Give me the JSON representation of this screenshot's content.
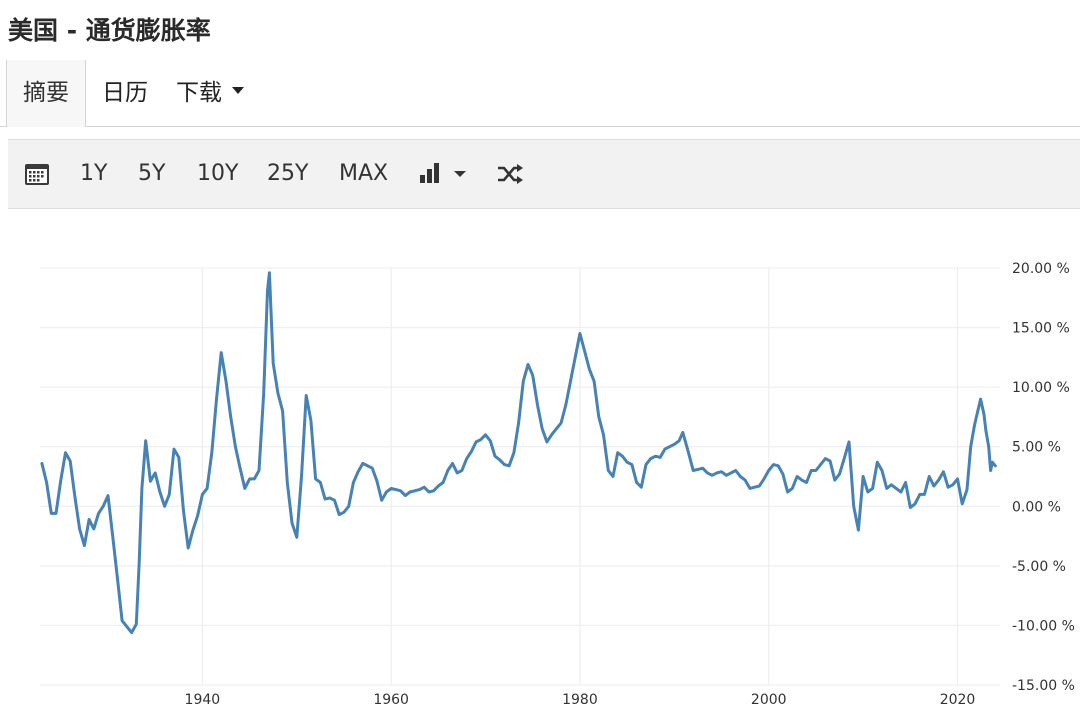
{
  "title": "美国 - 通货膨胀率",
  "tabs": [
    {
      "label": "摘要",
      "active": true
    },
    {
      "label": "日历"
    },
    {
      "label": "下载"
    }
  ],
  "toolbar": {
    "ranges": [
      "1Y",
      "5Y",
      "10Y",
      "25Y",
      "MAX"
    ],
    "icons": [
      "calendar-icon",
      "bar-chart-icon",
      "chevron-down-icon",
      "shuffle-icon"
    ]
  },
  "colors": {
    "line": "#4682b4",
    "grid": "#ececec",
    "toolbar_bg": "#f2f2f2"
  },
  "chart_data": {
    "type": "line",
    "title": "",
    "xlabel": "",
    "ylabel": "",
    "xlim": [
      1922.8,
      2024.5
    ],
    "ylim": [
      -15,
      20
    ],
    "x_ticks": [
      1940,
      1960,
      1980,
      2000,
      2020
    ],
    "y_ticks": [
      20,
      15,
      10,
      5,
      0,
      -5,
      -10,
      -15
    ],
    "y_tick_labels": [
      "20.00 %",
      "15.00 %",
      "10.00 %",
      "5.00 %",
      "0.00 %",
      "-5.00 %",
      "-10.00 %",
      "-15.00 %"
    ],
    "grid": true,
    "series": [
      {
        "points": [
          [
            1923.0,
            3.6
          ],
          [
            1923.5,
            2.0
          ],
          [
            1924.0,
            -0.6
          ],
          [
            1924.5,
            -0.6
          ],
          [
            1925.0,
            2.2
          ],
          [
            1925.5,
            4.5
          ],
          [
            1926.0,
            3.8
          ],
          [
            1926.5,
            0.8
          ],
          [
            1927.0,
            -1.9
          ],
          [
            1927.5,
            -3.3
          ],
          [
            1928.0,
            -1.1
          ],
          [
            1928.5,
            -1.9
          ],
          [
            1929.0,
            -0.6
          ],
          [
            1929.5,
            0.0
          ],
          [
            1930.0,
            0.9
          ],
          [
            1930.5,
            -2.5
          ],
          [
            1931.0,
            -6.0
          ],
          [
            1931.5,
            -9.6
          ],
          [
            1932.0,
            -10.1
          ],
          [
            1932.5,
            -10.6
          ],
          [
            1933.0,
            -9.9
          ],
          [
            1933.3,
            -4.9
          ],
          [
            1933.6,
            1.5
          ],
          [
            1934.0,
            5.5
          ],
          [
            1934.5,
            2.1
          ],
          [
            1935.0,
            2.8
          ],
          [
            1935.5,
            1.2
          ],
          [
            1936.0,
            0.0
          ],
          [
            1936.5,
            1.0
          ],
          [
            1937.0,
            4.8
          ],
          [
            1937.5,
            4.1
          ],
          [
            1938.0,
            -0.4
          ],
          [
            1938.5,
            -3.5
          ],
          [
            1939.0,
            -2.0
          ],
          [
            1939.5,
            -0.8
          ],
          [
            1940.0,
            1.0
          ],
          [
            1940.5,
            1.5
          ],
          [
            1941.0,
            4.5
          ],
          [
            1941.5,
            9.0
          ],
          [
            1942.0,
            12.9
          ],
          [
            1942.5,
            10.5
          ],
          [
            1943.0,
            7.5
          ],
          [
            1943.5,
            5.0
          ],
          [
            1944.0,
            3.2
          ],
          [
            1944.5,
            1.5
          ],
          [
            1945.0,
            2.3
          ],
          [
            1945.5,
            2.3
          ],
          [
            1946.0,
            3.0
          ],
          [
            1946.5,
            9.5
          ],
          [
            1946.9,
            18.1
          ],
          [
            1947.1,
            19.6
          ],
          [
            1947.5,
            12.0
          ],
          [
            1948.0,
            9.5
          ],
          [
            1948.5,
            8.0
          ],
          [
            1949.0,
            2.0
          ],
          [
            1949.5,
            -1.4
          ],
          [
            1950.0,
            -2.6
          ],
          [
            1950.5,
            2.5
          ],
          [
            1951.0,
            9.3
          ],
          [
            1951.5,
            7.2
          ],
          [
            1952.0,
            2.3
          ],
          [
            1952.5,
            2.0
          ],
          [
            1953.0,
            0.6
          ],
          [
            1953.5,
            0.7
          ],
          [
            1954.0,
            0.5
          ],
          [
            1954.5,
            -0.7
          ],
          [
            1955.0,
            -0.5
          ],
          [
            1955.5,
            0.0
          ],
          [
            1956.0,
            2.0
          ],
          [
            1956.5,
            2.9
          ],
          [
            1957.0,
            3.6
          ],
          [
            1957.5,
            3.4
          ],
          [
            1958.0,
            3.2
          ],
          [
            1958.5,
            2.1
          ],
          [
            1959.0,
            0.5
          ],
          [
            1959.5,
            1.2
          ],
          [
            1960.0,
            1.5
          ],
          [
            1960.5,
            1.4
          ],
          [
            1961.0,
            1.3
          ],
          [
            1961.5,
            0.9
          ],
          [
            1962.0,
            1.2
          ],
          [
            1962.5,
            1.3
          ],
          [
            1963.0,
            1.4
          ],
          [
            1963.5,
            1.6
          ],
          [
            1964.0,
            1.2
          ],
          [
            1964.5,
            1.3
          ],
          [
            1965.0,
            1.7
          ],
          [
            1965.5,
            2.0
          ],
          [
            1966.0,
            3.0
          ],
          [
            1966.5,
            3.6
          ],
          [
            1967.0,
            2.8
          ],
          [
            1967.5,
            3.0
          ],
          [
            1968.0,
            4.0
          ],
          [
            1968.5,
            4.6
          ],
          [
            1969.0,
            5.4
          ],
          [
            1969.5,
            5.6
          ],
          [
            1970.0,
            6.0
          ],
          [
            1970.5,
            5.5
          ],
          [
            1971.0,
            4.2
          ],
          [
            1971.5,
            3.9
          ],
          [
            1972.0,
            3.5
          ],
          [
            1972.5,
            3.4
          ],
          [
            1973.0,
            4.5
          ],
          [
            1973.5,
            7.0
          ],
          [
            1974.0,
            10.5
          ],
          [
            1974.5,
            11.9
          ],
          [
            1975.0,
            11.0
          ],
          [
            1975.5,
            8.5
          ],
          [
            1976.0,
            6.5
          ],
          [
            1976.5,
            5.4
          ],
          [
            1977.0,
            6.0
          ],
          [
            1977.5,
            6.5
          ],
          [
            1978.0,
            7.0
          ],
          [
            1978.5,
            8.5
          ],
          [
            1979.0,
            10.5
          ],
          [
            1979.5,
            12.5
          ],
          [
            1980.0,
            14.5
          ],
          [
            1980.5,
            13.0
          ],
          [
            1981.0,
            11.5
          ],
          [
            1981.5,
            10.5
          ],
          [
            1982.0,
            7.5
          ],
          [
            1982.5,
            6.0
          ],
          [
            1983.0,
            3.0
          ],
          [
            1983.5,
            2.5
          ],
          [
            1984.0,
            4.5
          ],
          [
            1984.5,
            4.2
          ],
          [
            1985.0,
            3.7
          ],
          [
            1985.5,
            3.5
          ],
          [
            1986.0,
            2.0
          ],
          [
            1986.5,
            1.6
          ],
          [
            1987.0,
            3.5
          ],
          [
            1987.5,
            4.0
          ],
          [
            1988.0,
            4.2
          ],
          [
            1988.5,
            4.1
          ],
          [
            1989.0,
            4.8
          ],
          [
            1989.5,
            5.0
          ],
          [
            1990.0,
            5.2
          ],
          [
            1990.5,
            5.5
          ],
          [
            1990.9,
            6.2
          ],
          [
            1991.5,
            4.5
          ],
          [
            1992.0,
            3.0
          ],
          [
            1992.5,
            3.1
          ],
          [
            1993.0,
            3.2
          ],
          [
            1993.5,
            2.8
          ],
          [
            1994.0,
            2.6
          ],
          [
            1994.5,
            2.8
          ],
          [
            1995.0,
            2.9
          ],
          [
            1995.5,
            2.6
          ],
          [
            1996.0,
            2.8
          ],
          [
            1996.5,
            3.0
          ],
          [
            1997.0,
            2.5
          ],
          [
            1997.5,
            2.2
          ],
          [
            1998.0,
            1.5
          ],
          [
            1998.5,
            1.6
          ],
          [
            1999.0,
            1.7
          ],
          [
            1999.5,
            2.3
          ],
          [
            2000.0,
            3.0
          ],
          [
            2000.5,
            3.5
          ],
          [
            2001.0,
            3.4
          ],
          [
            2001.5,
            2.7
          ],
          [
            2002.0,
            1.2
          ],
          [
            2002.5,
            1.5
          ],
          [
            2003.0,
            2.5
          ],
          [
            2003.5,
            2.2
          ],
          [
            2004.0,
            2.0
          ],
          [
            2004.5,
            3.0
          ],
          [
            2005.0,
            3.0
          ],
          [
            2005.5,
            3.5
          ],
          [
            2006.0,
            4.0
          ],
          [
            2006.5,
            3.8
          ],
          [
            2007.0,
            2.2
          ],
          [
            2007.5,
            2.7
          ],
          [
            2008.0,
            4.0
          ],
          [
            2008.5,
            5.4
          ],
          [
            2009.0,
            0.0
          ],
          [
            2009.5,
            -2.0
          ],
          [
            2010.0,
            2.5
          ],
          [
            2010.5,
            1.2
          ],
          [
            2011.0,
            1.5
          ],
          [
            2011.5,
            3.7
          ],
          [
            2012.0,
            3.0
          ],
          [
            2012.5,
            1.5
          ],
          [
            2013.0,
            1.8
          ],
          [
            2013.5,
            1.5
          ],
          [
            2014.0,
            1.2
          ],
          [
            2014.5,
            2.0
          ],
          [
            2015.0,
            -0.1
          ],
          [
            2015.5,
            0.2
          ],
          [
            2016.0,
            1.0
          ],
          [
            2016.5,
            1.0
          ],
          [
            2017.0,
            2.5
          ],
          [
            2017.5,
            1.7
          ],
          [
            2018.0,
            2.2
          ],
          [
            2018.5,
            2.9
          ],
          [
            2019.0,
            1.6
          ],
          [
            2019.5,
            1.8
          ],
          [
            2020.0,
            2.3
          ],
          [
            2020.5,
            0.2
          ],
          [
            2021.0,
            1.4
          ],
          [
            2021.4,
            5.0
          ],
          [
            2021.8,
            6.8
          ],
          [
            2022.0,
            7.5
          ],
          [
            2022.45,
            9.0
          ],
          [
            2022.8,
            7.7
          ],
          [
            2023.0,
            6.4
          ],
          [
            2023.3,
            5.0
          ],
          [
            2023.5,
            3.0
          ],
          [
            2023.7,
            3.7
          ],
          [
            2024.0,
            3.4
          ]
        ]
      }
    ]
  }
}
